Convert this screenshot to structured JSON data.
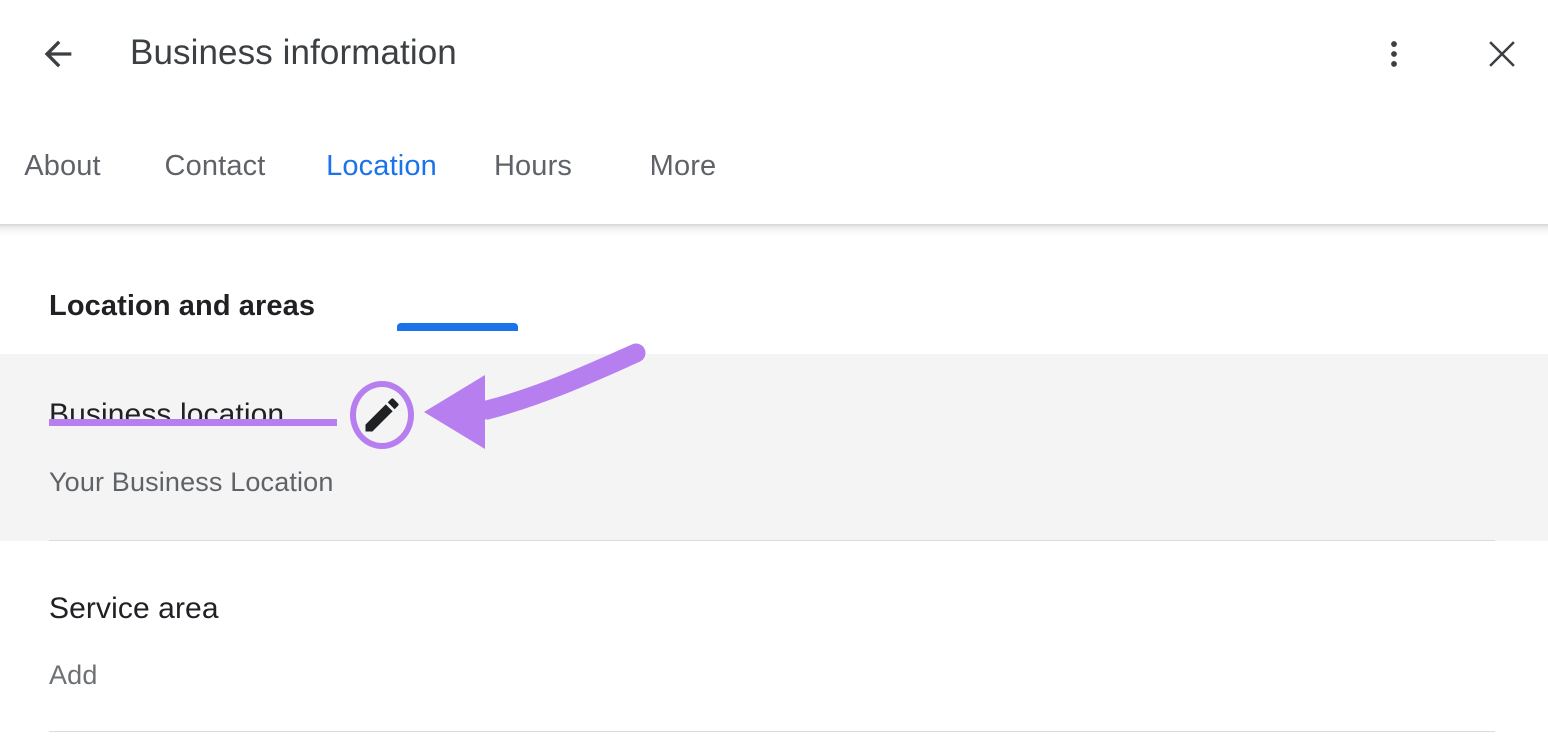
{
  "header": {
    "title": "Business information",
    "back_icon": "arrow-left-icon",
    "menu_icon": "kebab-menu-icon",
    "close_icon": "close-icon"
  },
  "tabs": {
    "items": [
      {
        "label": "About",
        "active": false
      },
      {
        "label": "Contact",
        "active": false
      },
      {
        "label": "Location",
        "active": true
      },
      {
        "label": "Hours",
        "active": false
      },
      {
        "label": "More",
        "active": false
      }
    ],
    "active_index": 2
  },
  "content": {
    "section_heading": "Location and areas",
    "rows": [
      {
        "label": "Business location",
        "value": "Your Business Location",
        "highlighted": true,
        "edit_icon": "pencil-edit-icon"
      },
      {
        "label": "Service area",
        "value": "Add",
        "highlighted": false
      }
    ]
  },
  "annotation": {
    "arrow_icon": "curved-left-arrow-annotation",
    "circle_icon": "circle-highlight-annotation",
    "underline_icon": "underline-highlight-annotation"
  },
  "colors": {
    "accent_blue": "#1a73e8",
    "annotation_purple": "#b77ef0",
    "text_primary": "#202124",
    "text_secondary": "#5f6368",
    "row_highlight_bg": "#f4f4f4",
    "divider": "#dadce0"
  }
}
